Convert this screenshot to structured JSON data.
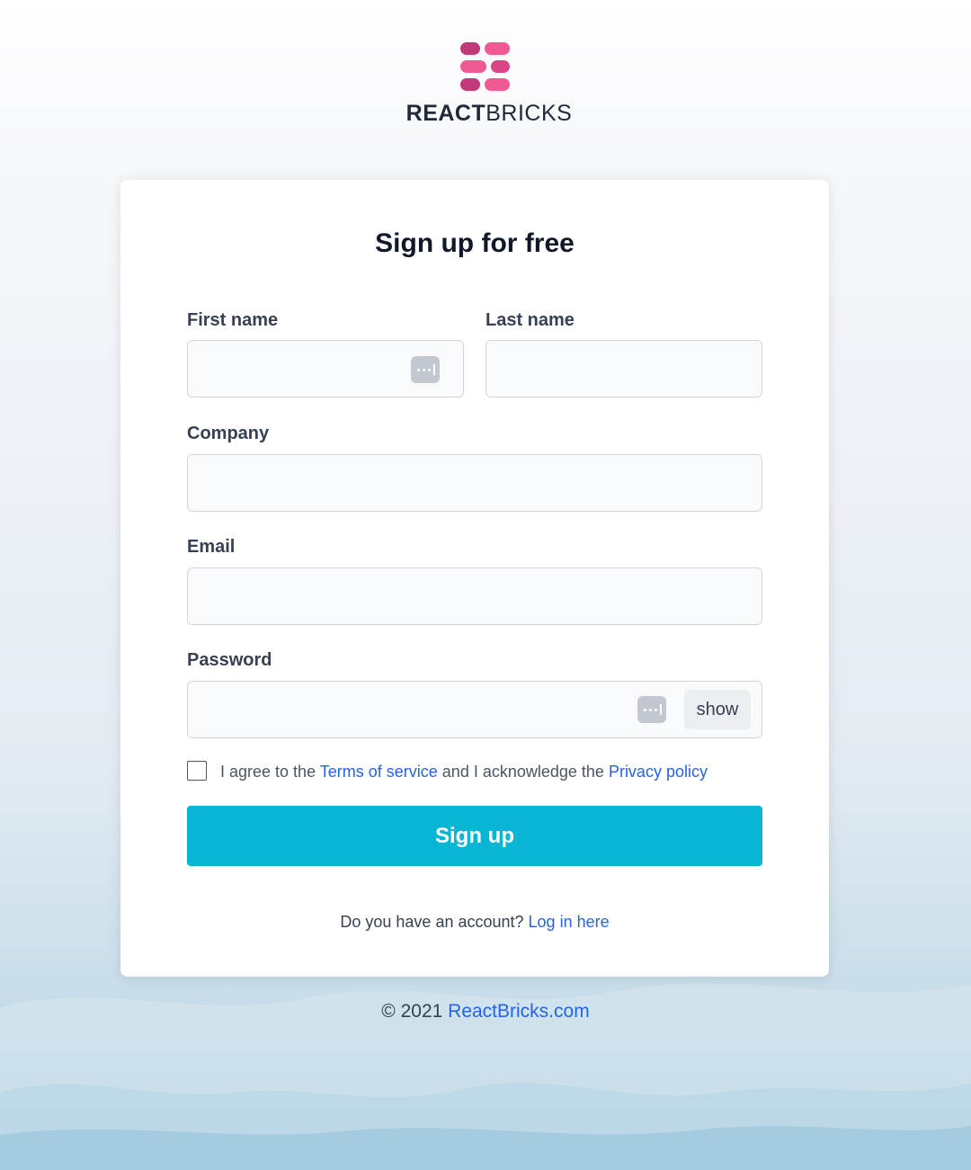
{
  "brand": {
    "name_bold": "REACT",
    "name_light": "BRICKS",
    "logo_colors": [
      "#c03a7a",
      "#ee5a91",
      "#d94587"
    ]
  },
  "form": {
    "title": "Sign up for free",
    "first_name": {
      "label": "First name",
      "value": ""
    },
    "last_name": {
      "label": "Last name",
      "value": ""
    },
    "company": {
      "label": "Company",
      "value": ""
    },
    "email": {
      "label": "Email",
      "value": ""
    },
    "password": {
      "label": "Password",
      "value": "",
      "show_label": "show"
    },
    "agree": {
      "checked": false,
      "text_before": "I agree to the ",
      "terms_link": "Terms of service",
      "text_middle": " and I acknowledge the ",
      "privacy_link": "Privacy policy"
    },
    "submit_label": "Sign up",
    "login_prompt": "Do you have an account? ",
    "login_link": "Log in here"
  },
  "footer": {
    "copyright": "© 2021 ",
    "site_link": "ReactBricks.com"
  },
  "colors": {
    "accent": "#06b6d4",
    "link": "#2563eb"
  },
  "icons": {
    "autofill": "password-manager-icon"
  }
}
